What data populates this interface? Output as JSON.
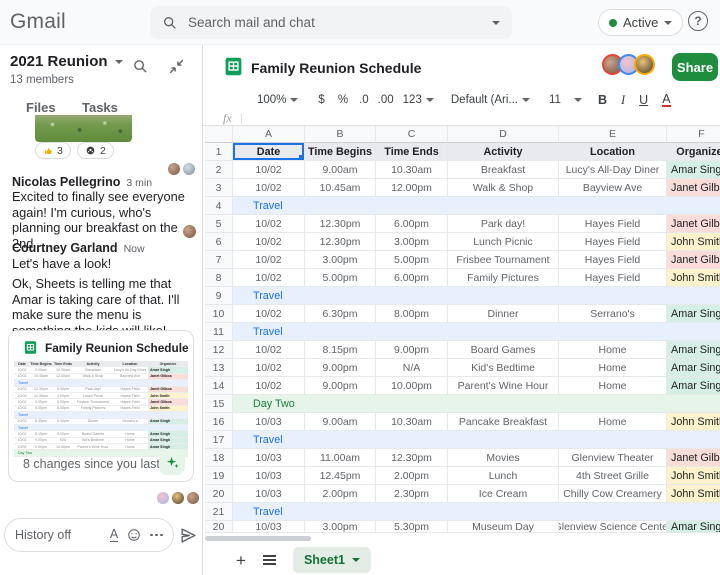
{
  "topbar": {
    "logo": "Gmail",
    "search_placeholder": "Search mail and chat",
    "status": "Active",
    "help_glyph": "?"
  },
  "chat": {
    "space_name": "2021 Reunion",
    "member_count": "13 members",
    "tabs": [
      {
        "label": "Files"
      },
      {
        "label": "Tasks"
      }
    ],
    "reactions": [
      {
        "icon": "thumbs-up",
        "count": "3"
      },
      {
        "icon": "soccer-ball",
        "count": "2"
      }
    ],
    "messages": [
      {
        "sender": "Nicolas Pellegrino",
        "time": "3 min",
        "texts": [
          "Excited to finally see everyone again! I'm curious, who's planning our breakfast on the 2nd"
        ]
      },
      {
        "sender": "Courtney Garland",
        "time": "Now",
        "texts": [
          "Let's have a look!",
          "Ok, Sheets is telling me that Amar is taking care of that. I'll make sure the menu is something the kids will like!"
        ]
      }
    ],
    "file_card": {
      "title": "Family Reunion Schedule",
      "footer": "8 changes since you last..."
    },
    "compose_placeholder": "History off"
  },
  "sheets": {
    "title": "Family Reunion Schedule",
    "share_label": "Share",
    "toolbar": {
      "zoom": "100%",
      "currency": "$",
      "percent": "%",
      "dec0": ".0",
      "dec00": ".00",
      "fmt": "123",
      "font": "Default (Ari...",
      "size": "11",
      "bold": "B",
      "italic": "I",
      "underline": "U",
      "textcolor": "A"
    },
    "formula_glyph": "fx",
    "tab_name": "Sheet1",
    "grid": {
      "columns": [
        "A",
        "B",
        "C",
        "D",
        "E",
        "F"
      ],
      "rows": [
        {
          "n": "1",
          "type": "head",
          "cells": [
            "Date",
            "Time Begins",
            "Time Ends",
            "Activity",
            "Location",
            "Organizer"
          ]
        },
        {
          "n": "2",
          "type": "data",
          "date": "10/02",
          "begins": "9.00am",
          "ends": "10.30am",
          "activity": "Breakfast",
          "location": "Lucy's All-Day Diner",
          "organizer": "Amar Singh",
          "color": "teal"
        },
        {
          "n": "3",
          "type": "data",
          "date": "10/02",
          "begins": "10.45am",
          "ends": "12.00pm",
          "activity": "Walk & Shop",
          "location": "Bayview Ave",
          "organizer": "Janet Gilboa",
          "color": "pink"
        },
        {
          "n": "4",
          "type": "banner",
          "label": "Travel",
          "style": "travel"
        },
        {
          "n": "5",
          "type": "data",
          "date": "10/02",
          "begins": "12.30pm",
          "ends": "6.00pm",
          "activity": "Park day!",
          "location": "Hayes Field",
          "organizer": "Janet Gilboa",
          "color": "pink"
        },
        {
          "n": "6",
          "type": "data",
          "date": "10/02",
          "begins": "12.30pm",
          "ends": "3.00pm",
          "activity": "Lunch Picnic",
          "location": "Hayes Field",
          "organizer": "John Smith",
          "color": "yellow"
        },
        {
          "n": "7",
          "type": "data",
          "date": "10/02",
          "begins": "3.00pm",
          "ends": "5.00pm",
          "activity": "Frisbee Tournament",
          "location": "Hayes Field",
          "organizer": "Janet Gilboa",
          "color": "pink"
        },
        {
          "n": "8",
          "type": "data",
          "date": "10/02",
          "begins": "5.00pm",
          "ends": "6.00pm",
          "activity": "Family Pictures",
          "location": "Hayes Field",
          "organizer": "John Smith",
          "color": "yellow"
        },
        {
          "n": "9",
          "type": "banner",
          "label": "Travel",
          "style": "travel"
        },
        {
          "n": "10",
          "type": "data",
          "date": "10/02",
          "begins": "6.30pm",
          "ends": "8.00pm",
          "activity": "Dinner",
          "location": "Serrano's",
          "organizer": "Amar Singh",
          "color": "teal"
        },
        {
          "n": "11",
          "type": "banner",
          "label": "Travel",
          "style": "travel"
        },
        {
          "n": "12",
          "type": "data",
          "date": "10/02",
          "begins": "8.15pm",
          "ends": "9.00pm",
          "activity": "Board Games",
          "location": "Home",
          "organizer": "Amar Singh",
          "color": "teal"
        },
        {
          "n": "13",
          "type": "data",
          "date": "10/02",
          "begins": "9.00pm",
          "ends": "N/A",
          "activity": "Kid's Bedtime",
          "location": "Home",
          "organizer": "Amar Singh",
          "color": "teal"
        },
        {
          "n": "14",
          "type": "data",
          "date": "10/02",
          "begins": "9.00pm",
          "ends": "10.00pm",
          "activity": "Parent's Wine Hour",
          "location": "Home",
          "organizer": "Amar Singh",
          "color": "teal"
        },
        {
          "n": "15",
          "type": "banner",
          "label": "Day Two",
          "style": "day"
        },
        {
          "n": "16",
          "type": "data",
          "date": "10/03",
          "begins": "9.00am",
          "ends": "10.30am",
          "activity": "Pancake Breakfast",
          "location": "Home",
          "organizer": "John Smith",
          "color": "yellow"
        },
        {
          "n": "17",
          "type": "banner",
          "label": "Travel",
          "style": "travel"
        },
        {
          "n": "18",
          "type": "data",
          "date": "10/03",
          "begins": "11.00am",
          "ends": "12.30pm",
          "activity": "Movies",
          "location": "Glenview Theater",
          "organizer": "Janet Gilboa",
          "color": "pink"
        },
        {
          "n": "19",
          "type": "data",
          "date": "10/03",
          "begins": "12.45pm",
          "ends": "2.00pm",
          "activity": "Lunch",
          "location": "4th Street Grille",
          "organizer": "John Smith",
          "color": "yellow"
        },
        {
          "n": "20",
          "type": "data",
          "date": "10/03",
          "begins": "2.00pm",
          "ends": "2.30pm",
          "activity": "Ice Cream",
          "location": "Chilly Cow Creamery",
          "organizer": "John Smith",
          "color": "yellow"
        },
        {
          "n": "21",
          "type": "banner",
          "label": "Travel",
          "style": "travel"
        },
        {
          "n": "20",
          "type": "data",
          "partial": true,
          "date": "10/03",
          "begins": "3.00pm",
          "ends": "5.30pm",
          "activity": "Museum Day",
          "location": "Glenview Science Center",
          "organizer": "Amar Singh",
          "color": "teal"
        }
      ]
    }
  },
  "colors": {
    "accent_blue": "#1a73e8",
    "accent_green": "#188038",
    "travel_bg": "#e8f0fe",
    "day_bg": "#e6f4ea",
    "org_teal": "#d6efe6",
    "org_pink": "#fadcd9",
    "org_yellow": "#fdf2cc",
    "header_row_bg": "#e8eaed",
    "share_green": "#1e8e3e",
    "sheets_green": "#0f9d58",
    "tab_bg": "#e3ece5",
    "tab_green": "#137333",
    "grid_line": "#e7e8ea",
    "gutter_bg": "#f8f9fa",
    "text_primary": "#202124",
    "text_secondary": "#5f6368",
    "chip_border": "#dadce0",
    "search_bg": "#f1f3f4"
  }
}
